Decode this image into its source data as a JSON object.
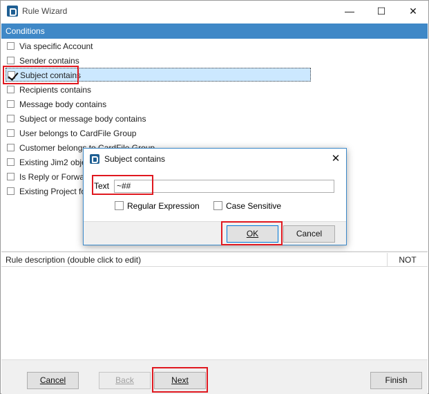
{
  "window": {
    "title": "Rule Wizard",
    "minimize_glyph": "—",
    "maximize_glyph": "☐",
    "close_glyph": "✕"
  },
  "conditions": {
    "header": "Conditions",
    "items": [
      {
        "label": "Via specific Account",
        "checked": false
      },
      {
        "label": "Sender contains",
        "checked": false
      },
      {
        "label": "Subject contains",
        "checked": true
      },
      {
        "label": "Recipients contains",
        "checked": false
      },
      {
        "label": "Message body contains",
        "checked": false
      },
      {
        "label": "Subject or message body contains",
        "checked": false
      },
      {
        "label": "User belongs to CardFile Group",
        "checked": false
      },
      {
        "label": "Customer belongs to CardFile Group",
        "checked": false
      },
      {
        "label": "Existing Jim2 object",
        "checked": false
      },
      {
        "label": "Is Reply or Forward",
        "checked": false
      },
      {
        "label": "Existing Project fou",
        "checked": false
      }
    ]
  },
  "description": {
    "header": "Rule description (double click to edit)",
    "not_column": "NOT"
  },
  "footer": {
    "cancel": "Cancel",
    "back": "Back",
    "next": "Next",
    "finish": "Finish"
  },
  "dialog": {
    "title": "Subject contains",
    "close_glyph": "✕",
    "text_label": "Text",
    "text_value": "~##",
    "regex_label": "Regular Expression",
    "case_label": "Case Sensitive",
    "ok": "OK",
    "cancel": "Cancel"
  },
  "colors": {
    "header_blue": "#3f88c7",
    "selection": "#cce8ff",
    "highlight_red": "#e0181f"
  }
}
